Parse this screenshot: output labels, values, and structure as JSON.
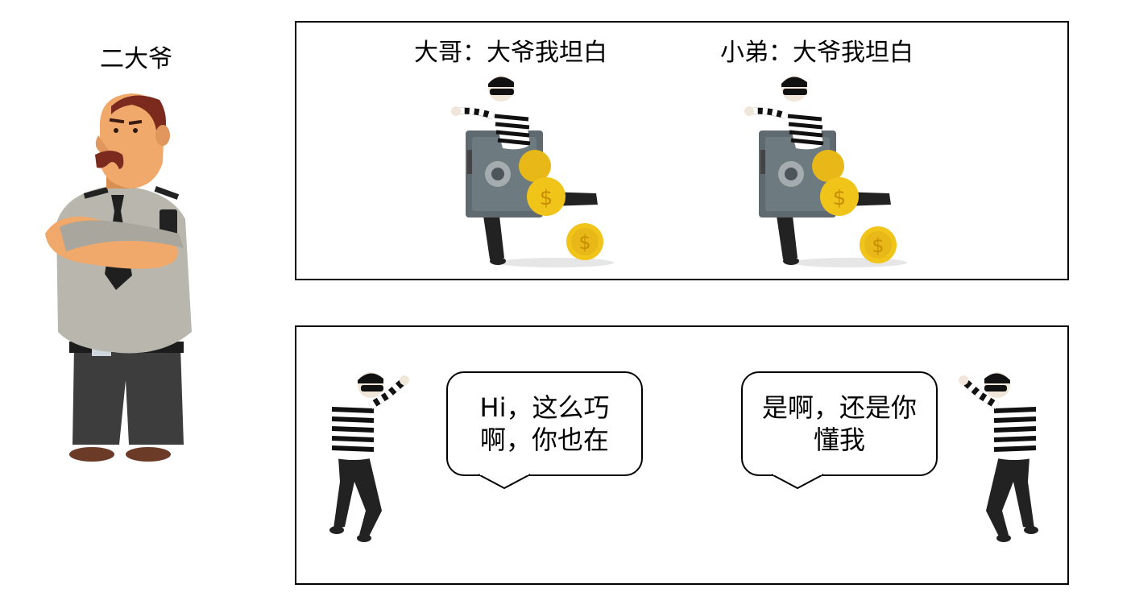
{
  "guard": {
    "label": "二大爷"
  },
  "top_panel": {
    "left_caption": "大哥：大爷我坦白",
    "right_caption": "小弟：大爷我坦白"
  },
  "bottom_panel": {
    "left_bubble": "Hi，这么巧\n啊，你也在",
    "right_bubble": "是啊，还是你\n懂我"
  },
  "icons": [
    "guard-figure",
    "thief-with-safe-figure",
    "coin-icon",
    "thief-figure"
  ],
  "colors": {
    "border": "#000000",
    "safe": "#5e6a70",
    "coin": "#f0c419",
    "guard_shirt": "#b9b6ad",
    "guard_pants": "#3d3d3d",
    "skin": "#f0a96a",
    "hair": "#7b2a1d"
  }
}
